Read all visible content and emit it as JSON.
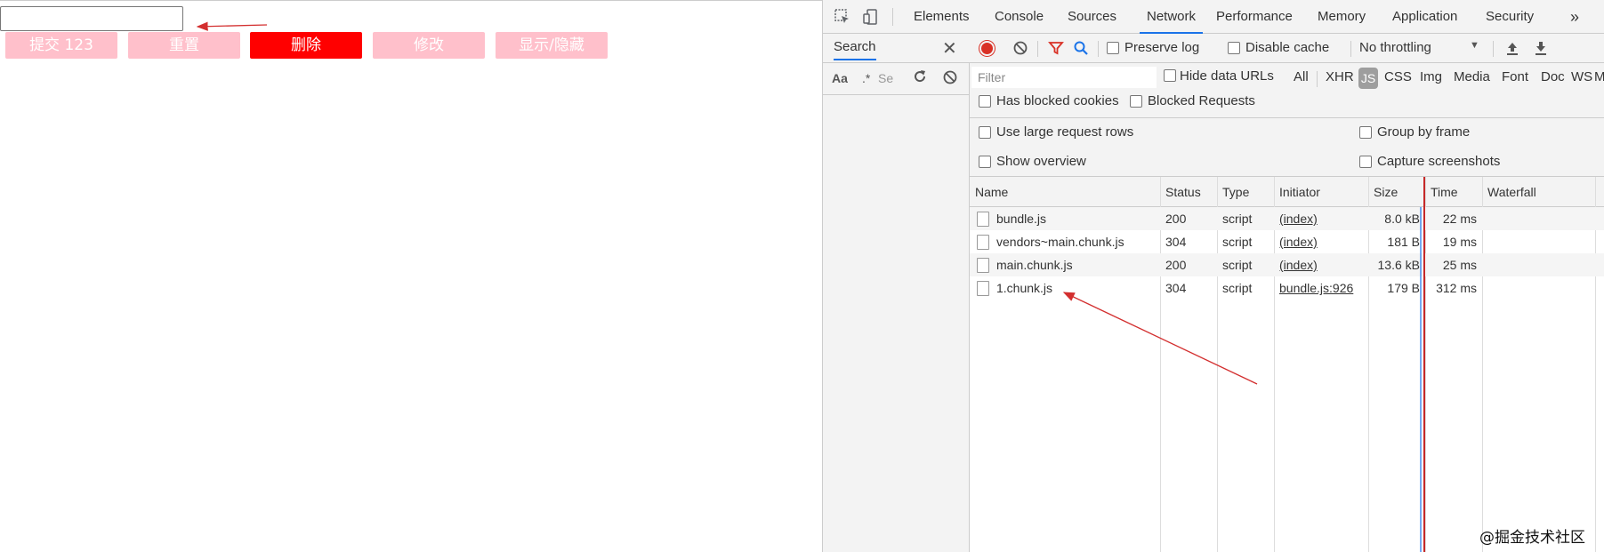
{
  "page": {
    "input_value": "",
    "buttons": [
      "提交 123",
      "重置",
      "删除",
      "修改",
      "显示/隐藏"
    ]
  },
  "devtools": {
    "tabs": [
      "Elements",
      "Console",
      "Sources",
      "Network",
      "Performance",
      "Memory",
      "Application",
      "Security"
    ],
    "active_tab": "Network",
    "more_tabs_label": "»",
    "search": {
      "title": "Search",
      "close_label": "✕",
      "match_case_label": "Aa",
      "regex_label": ".*",
      "input_placeholder": "Se"
    },
    "toolbar": {
      "preserve_log": "Preserve log",
      "disable_cache": "Disable cache",
      "throttling": "No throttling",
      "throttling_arrow": "▼"
    },
    "filter": {
      "placeholder": "Filter",
      "hide_data_urls": "Hide data URLs",
      "types": [
        "All",
        "XHR",
        "JS",
        "CSS",
        "Img",
        "Media",
        "Font",
        "Doc",
        "WS",
        "M"
      ],
      "active_type": "JS",
      "has_blocked_cookies": "Has blocked cookies",
      "blocked_requests": "Blocked Requests"
    },
    "settings": {
      "large_rows": "Use large request rows",
      "group_by_frame": "Group by frame",
      "show_overview": "Show overview",
      "capture_screenshots": "Capture screenshots"
    },
    "columns": [
      "Name",
      "Status",
      "Type",
      "Initiator",
      "Size",
      "Time",
      "Waterfall"
    ],
    "rows": [
      {
        "name": "bundle.js",
        "status": "200",
        "type": "script",
        "initiator": "(index)",
        "size": "8.0 kB",
        "time": "22 ms"
      },
      {
        "name": "vendors~main.chunk.js",
        "status": "304",
        "type": "script",
        "initiator": "(index)",
        "size": "181 B",
        "time": "19 ms"
      },
      {
        "name": "main.chunk.js",
        "status": "200",
        "type": "script",
        "initiator": "(index)",
        "size": "13.6 kB",
        "time": "25 ms"
      },
      {
        "name": "1.chunk.js",
        "status": "304",
        "type": "script",
        "initiator": "bundle.js:926",
        "size": "179 B",
        "time": "312 ms"
      }
    ]
  },
  "watermark": "@掘金技术社区",
  "colors": {
    "button_pink": "#ffc0cb",
    "button_red": "#ff0000",
    "record_red": "#d93025",
    "annotation_red": "#d32f2f",
    "accent_blue": "#1a73e8"
  }
}
